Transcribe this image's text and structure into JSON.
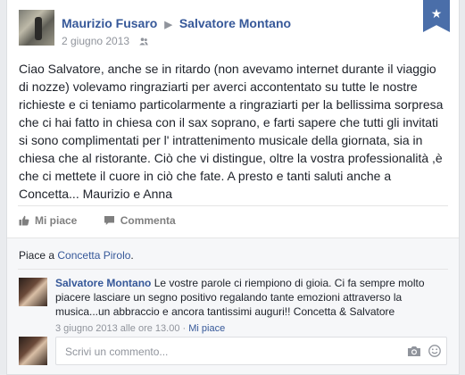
{
  "post": {
    "author": "Maurizio Fusaro",
    "recipient": "Salvatore Montano",
    "date": "2 giugno 2013",
    "audience_icon": "friends-icon",
    "bookmark_icon": "star-icon",
    "text": "Ciao Salvatore, anche se in ritardo (non avevamo internet durante il viaggio di nozze) volevamo ringraziarti per averci accontentato su tutte le nostre richieste e ci teniamo particolarmente a ringraziarti per la bellissima sorpresa che ci hai fatto in chiesa con il sax soprano, e farti sapere che tutti gli invitati si sono complimentati per l' intrattenimento musicale della giornata, sia in chiesa che al ristorante. Ciò che vi distingue, oltre la vostra professionalità ,è che ci mettete il cuore in ciò che fate. A presto e tanti saluti anche a Concetta... Maurizio e Anna"
  },
  "actions": {
    "like_label": "Mi piace",
    "comment_label": "Commenta"
  },
  "likes": {
    "prefix": "Piace a",
    "name": "Concetta Pirolo",
    "suffix": "."
  },
  "comment": {
    "author": "Salvatore Montano",
    "text": "Le vostre parole ci riempiono di gioia. Ci fa sempre molto piacere lasciare un segno positivo regalando tante emozioni attraverso la musica...un abbraccio e ancora tantissimi auguri!! Concetta & Salvatore",
    "timestamp": "3 giugno 2013 alle ore 13.00",
    "separator": "·",
    "like_label": "Mi piace"
  },
  "composer": {
    "placeholder": "Scrivi un commento..."
  },
  "colors": {
    "link": "#365899",
    "bookmark": "#4a6ea9",
    "meta": "#90949c"
  }
}
